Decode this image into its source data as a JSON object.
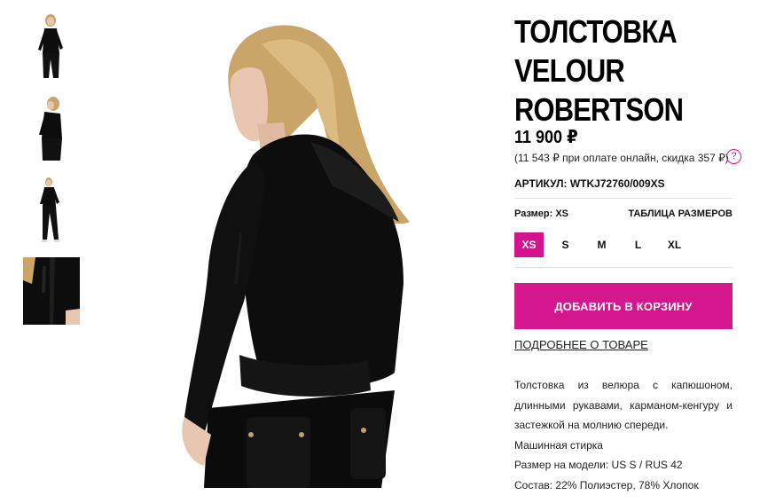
{
  "thumbnails": [
    {
      "icon": "model-front-thumbnail"
    },
    {
      "icon": "model-side-thumbnail"
    },
    {
      "icon": "model-full-length-thumbnail"
    },
    {
      "icon": "velour-closeup-thumbnail"
    }
  ],
  "main_image": {
    "icon": "model-back-view-photo"
  },
  "product": {
    "title": "ТОЛСТОВКА VELOUR ROBERTSON",
    "price": "11 900 ₽",
    "online_price": "(11 543 ₽ при оплате онлайн, скидка 357 ₽)",
    "help_icon": "?",
    "sku_label": "АРТИКУЛ:",
    "sku_value": "WTKJ72760/009XS"
  },
  "size": {
    "label": "Размер: XS",
    "table_link": "ТАБЛИЦА РАЗМЕРОВ",
    "options": [
      "XS",
      "S",
      "M",
      "L",
      "XL"
    ],
    "selected": "XS"
  },
  "actions": {
    "add_to_cart": "ДОБАВИТЬ В КОРЗИНУ",
    "details_link": "ПОДРОБНЕЕ О ТОВАРЕ"
  },
  "description": {
    "text": "Толстовка из велюра с капюшоном, длинными рукавами, карманом-кенгуру и застежкой на молнию спереди.",
    "care": "Машинная стирка",
    "model_size": "Размер на модели: US S / RUS 42",
    "composition": "Состав: 22% Полиэстер, 78% Хлопок"
  },
  "colors": {
    "accent": "#d5178e",
    "garment": "#0d0d0d",
    "hair": "#c9a56a",
    "skin": "#e8c6b0"
  }
}
